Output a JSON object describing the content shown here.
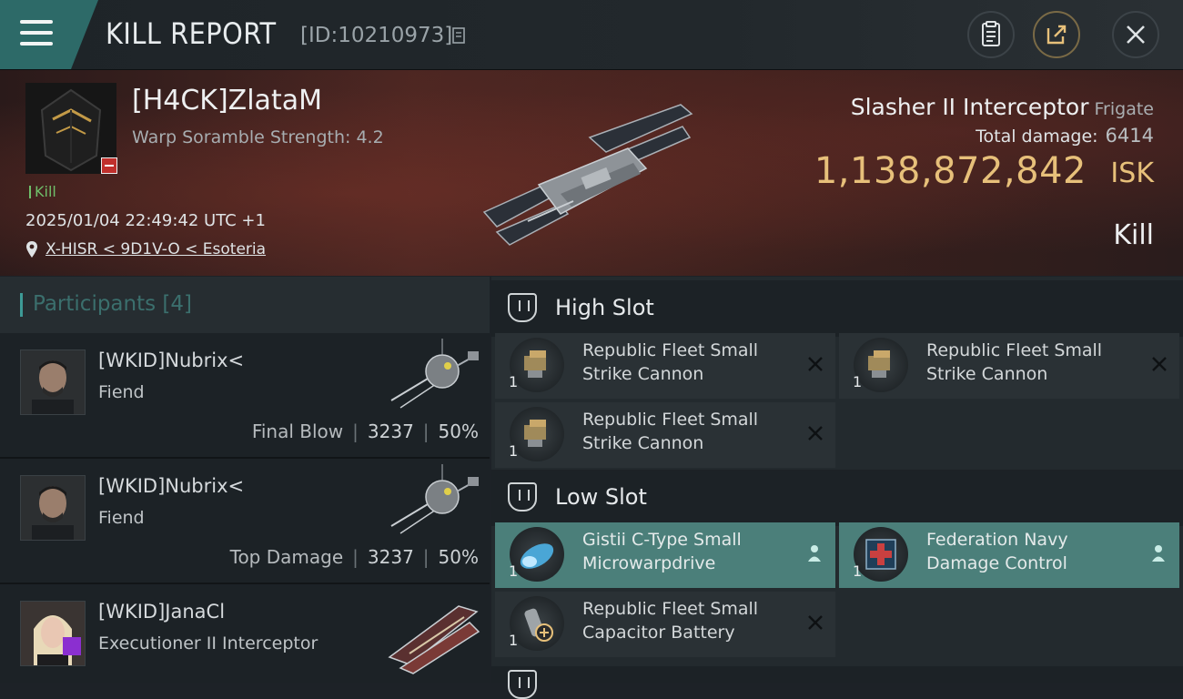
{
  "header": {
    "title": "KILL REPORT",
    "report_id": "[ID:10210973]",
    "icons": [
      "menu-icon",
      "copy-icon",
      "clipboard-icon",
      "share-icon",
      "close-icon"
    ]
  },
  "victim": {
    "name": "[H4CK]ZlataM",
    "subtitle": "Warp Soramble Strength: 4.2",
    "kill_tag": "Kill",
    "timestamp": "2025/01/04 22:49:42 UTC +1",
    "location": "X-HISR < 9D1V-O < Esoteria",
    "ship_name": "Slasher II Interceptor",
    "ship_class": "Frigate",
    "total_damage_label": "Total damage:",
    "total_damage": "6414",
    "isk_value": "1,138,872,842",
    "isk_unit": "ISK",
    "outcome": "Kill"
  },
  "participants": {
    "title": "Participants [4]",
    "rows": [
      {
        "name": "[WKID]Nubrix<",
        "ship": "Fiend",
        "role": "Final Blow",
        "damage": "3237",
        "percent": "50%"
      },
      {
        "name": "[WKID]Nubrix<",
        "ship": "Fiend",
        "role": "Top Damage",
        "damage": "3237",
        "percent": "50%"
      },
      {
        "name": "[WKID]JanaCl",
        "ship": "Executioner II Interceptor"
      }
    ]
  },
  "slots": {
    "high": {
      "label": "High Slot",
      "modules": [
        {
          "qty": "1",
          "name_1": "Republic Fleet Small",
          "name_2": "Strike Cannon"
        },
        {
          "qty": "1",
          "name_1": "Republic Fleet Small",
          "name_2": "Strike Cannon"
        },
        {
          "qty": "1",
          "name_1": "Republic Fleet Small",
          "name_2": "Strike Cannon"
        }
      ]
    },
    "low": {
      "label": "Low Slot",
      "modules": [
        {
          "qty": "1",
          "name_1": "Gistii C-Type Small",
          "name_2": "Microwarpdrive"
        },
        {
          "qty": "1",
          "name_1": "Federation Navy",
          "name_2": "Damage Control"
        },
        {
          "qty": "1",
          "name_1": "Republic Fleet Small",
          "name_2": "Capacitor Battery"
        }
      ]
    }
  },
  "colors": {
    "accent_teal": "#2d6a68",
    "isk_gold": "#e7c07a",
    "fitted_module": "#4b7f7a",
    "kill_green": "#6fbf6a"
  }
}
